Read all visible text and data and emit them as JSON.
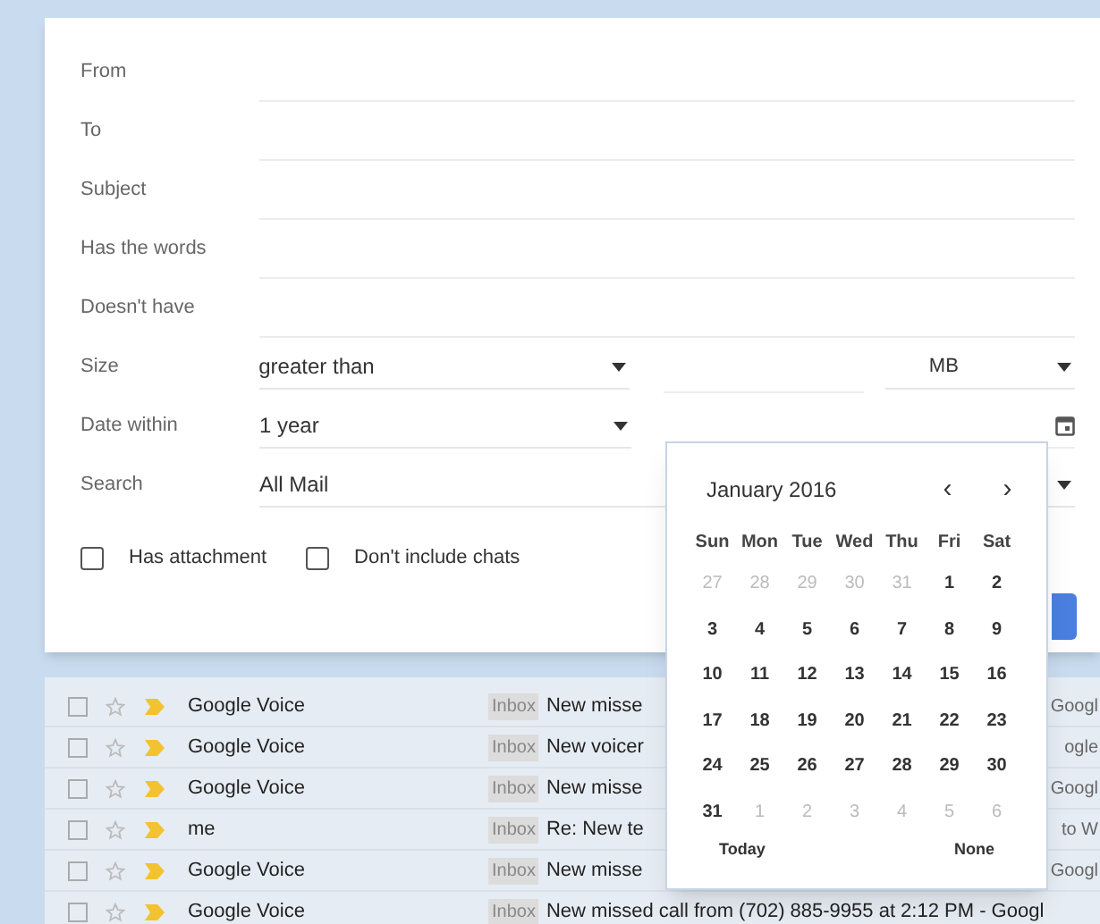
{
  "search_form": {
    "fields": [
      {
        "label": "From",
        "kind": "text"
      },
      {
        "label": "To",
        "kind": "text"
      },
      {
        "label": "Subject",
        "kind": "text"
      },
      {
        "label": "Has the words",
        "kind": "text"
      },
      {
        "label": "Doesn't have",
        "kind": "text"
      },
      {
        "label": "Size",
        "kind": "size",
        "operator": "greater than",
        "unit": "MB"
      },
      {
        "label": "Date within",
        "kind": "date",
        "range": "1 year"
      },
      {
        "label": "Search",
        "kind": "select",
        "value": "All Mail"
      }
    ],
    "checkboxes": [
      {
        "label": "Has attachment",
        "checked": false
      },
      {
        "label": "Don't include chats",
        "checked": false
      }
    ]
  },
  "emails": [
    {
      "sender": "Google Voice",
      "label": "Inbox",
      "subject": "New misse",
      "subject_tail": "Googl",
      "checked": false,
      "starred": false
    },
    {
      "sender": "Google Voice",
      "label": "Inbox",
      "subject": "New voicer",
      "subject_tail": "ogle",
      "checked": false,
      "starred": false
    },
    {
      "sender": "Google Voice",
      "label": "Inbox",
      "subject": "New misse",
      "subject_tail": "Googl",
      "checked": false,
      "starred": false
    },
    {
      "sender": "me",
      "label": "Inbox",
      "subject": "Re: New te",
      "subject_tail": "to W",
      "checked": false,
      "starred": false
    },
    {
      "sender": "Google Voice",
      "label": "Inbox",
      "subject": "New misse",
      "subject_tail": "Googl",
      "checked": false,
      "starred": false
    },
    {
      "sender": "Google Voice",
      "label": "Inbox",
      "subject": "New missed call from (702) 885-9955 at 2:12 PM - Googl",
      "checked": false,
      "starred": false
    }
  ],
  "date_picker": {
    "month": "January 2016",
    "prev": "‹",
    "next": "›",
    "weekdays": [
      "Sun",
      "Mon",
      "Tue",
      "Wed",
      "Thu",
      "Fri",
      "Sat"
    ],
    "days": [
      {
        "day": "27",
        "other_month": true
      },
      {
        "day": "28",
        "other_month": true
      },
      {
        "day": "29",
        "other_month": true
      },
      {
        "day": "30",
        "other_month": true
      },
      {
        "day": "31",
        "other_month": true
      },
      {
        "day": "1",
        "other_month": false
      },
      {
        "day": "2",
        "other_month": false
      },
      {
        "day": "3",
        "other_month": false
      },
      {
        "day": "4",
        "other_month": false
      },
      {
        "day": "5",
        "other_month": false
      },
      {
        "day": "6",
        "other_month": false
      },
      {
        "day": "7",
        "other_month": false
      },
      {
        "day": "8",
        "other_month": false
      },
      {
        "day": "9",
        "other_month": false
      },
      {
        "day": "10",
        "other_month": false
      },
      {
        "day": "11",
        "other_month": false
      },
      {
        "day": "12",
        "other_month": false
      },
      {
        "day": "13",
        "other_month": false
      },
      {
        "day": "14",
        "other_month": false
      },
      {
        "day": "15",
        "other_month": false
      },
      {
        "day": "16",
        "other_month": false
      },
      {
        "day": "17",
        "other_month": false
      },
      {
        "day": "18",
        "other_month": false
      },
      {
        "day": "19",
        "other_month": false
      },
      {
        "day": "20",
        "other_month": false
      },
      {
        "day": "21",
        "other_month": false
      },
      {
        "day": "22",
        "other_month": false
      },
      {
        "day": "23",
        "other_month": false
      },
      {
        "day": "24",
        "other_month": false
      },
      {
        "day": "25",
        "other_month": false
      },
      {
        "day": "26",
        "other_month": false
      },
      {
        "day": "27",
        "other_month": false
      },
      {
        "day": "28",
        "other_month": false
      },
      {
        "day": "29",
        "other_month": false
      },
      {
        "day": "30",
        "other_month": false
      },
      {
        "day": "31",
        "other_month": false
      },
      {
        "day": "1",
        "other_month": true
      },
      {
        "day": "2",
        "other_month": true
      },
      {
        "day": "3",
        "other_month": true
      },
      {
        "day": "4",
        "other_month": true
      },
      {
        "day": "5",
        "other_month": true
      },
      {
        "day": "6",
        "other_month": true
      }
    ],
    "today": "Today",
    "none": "None"
  }
}
